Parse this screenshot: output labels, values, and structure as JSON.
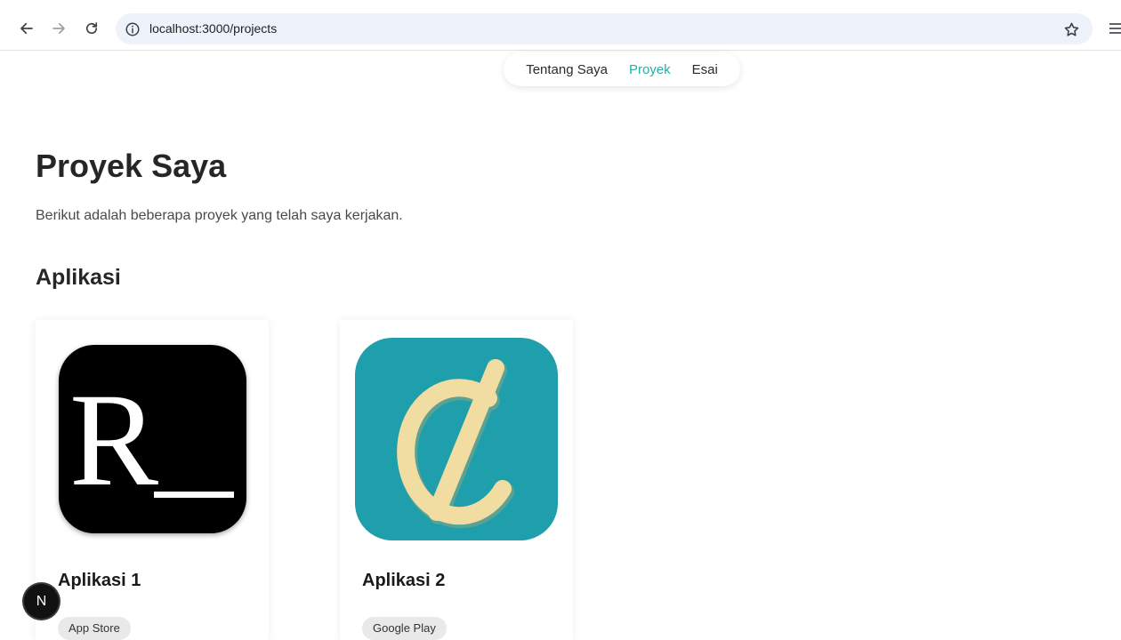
{
  "browser": {
    "url": "localhost:3000/projects"
  },
  "site_nav": {
    "items": [
      {
        "label": "Tentang Saya",
        "active": false
      },
      {
        "label": "Proyek",
        "active": true
      },
      {
        "label": "Esai",
        "active": false
      }
    ],
    "accent_color": "#1fb3a6"
  },
  "page": {
    "title": "Proyek Saya",
    "description": "Berikut adalah beberapa proyek yang telah saya kerjakan.",
    "section_title": "Aplikasi"
  },
  "projects": [
    {
      "title": "Aplikasi 1",
      "icon_letter": "R",
      "tag": "App Store",
      "icon_bg": "#000000"
    },
    {
      "title": "Aplikasi 2",
      "icon_symbol": "¢",
      "tag": "Google Play",
      "icon_bg": "#1f9eab"
    }
  ],
  "dev_badge": {
    "label": "N"
  }
}
